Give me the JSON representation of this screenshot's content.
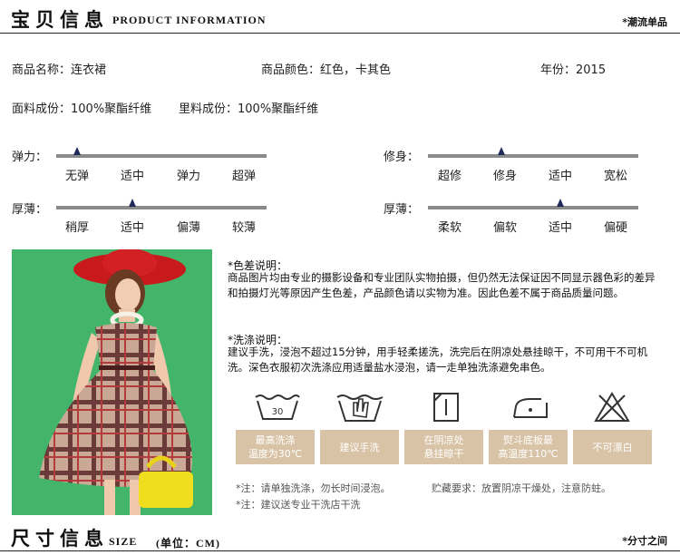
{
  "header": {
    "title_cn": "宝贝信息",
    "title_en": "PRODUCT INFORMATION",
    "right_label": "*潮流单品"
  },
  "product": {
    "name": "商品名称：连衣裙",
    "color": "商品颜色：红色，卡其色",
    "year": "年份：2015",
    "fabric": "面料成份：100%聚酯纤维",
    "lining": "里料成份：100%聚酯纤维"
  },
  "sliders": [
    {
      "label": "弹力：",
      "ticks": [
        "无弹",
        "适中",
        "弹力",
        "超弹"
      ],
      "level": 0.1
    },
    {
      "label": "修身：",
      "ticks": [
        "超修",
        "修身",
        "适中",
        "宽松"
      ],
      "level": 0.35
    },
    {
      "label": "厚薄：",
      "ticks": [
        "稍厚",
        "适中",
        "偏薄",
        "较薄"
      ],
      "level": 0.36
    },
    {
      "label": "厚薄：",
      "ticks": [
        "柔软",
        "偏软",
        "适中",
        "偏硬"
      ],
      "level": 0.63
    }
  ],
  "notes": {
    "color_title": "*色差说明：",
    "color_body": "商品图片均由专业的摄影设备和专业团队实物拍摄，但仍然无法保证因不同显示器色彩的差异和拍摄灯光等原因产生色差，产品颜色请以实物为准。因此色差不属于商品质量问题。",
    "wash_title": "*洗涤说明：",
    "wash_body": "建议手洗，浸泡不超过15分钟，用手轻柔搓洗，洗完后在阴凉处悬挂晾干，不可用干不可机洗。深色衣服初次洗涤应用适量盐水浸泡，请一走单独洗涤避免串色。"
  },
  "wash_icons": [
    {
      "icon": "wash-tub-30-icon",
      "temp": "30",
      "label": "最高洗涤\n温度为30℃"
    },
    {
      "icon": "hand-wash-icon",
      "label": "建议手洗"
    },
    {
      "icon": "line-dry-shade-icon",
      "label": "在阴凉处\n悬挂晾干"
    },
    {
      "icon": "iron-icon",
      "label": "熨斗底板最\n高温度110℃"
    },
    {
      "icon": "do-not-bleach-icon",
      "label": "不可漂白"
    }
  ],
  "footnotes": {
    "note1": "*注：请单独洗涤，勿长时间浸泡。",
    "storage": "贮藏要求：放置阴凉干燥处，注意防蛀。",
    "note2": "*注：建议送专业干洗店干洗"
  },
  "footer": {
    "title_cn": "尺寸信息",
    "title_en": "SIZE",
    "unit": "(单位：CM)",
    "right_label": "*分寸之间"
  },
  "colors": {
    "accent_bar": "#d9c3a6",
    "photo_bg": "#43b56a",
    "marker": "#1f2a5a"
  }
}
